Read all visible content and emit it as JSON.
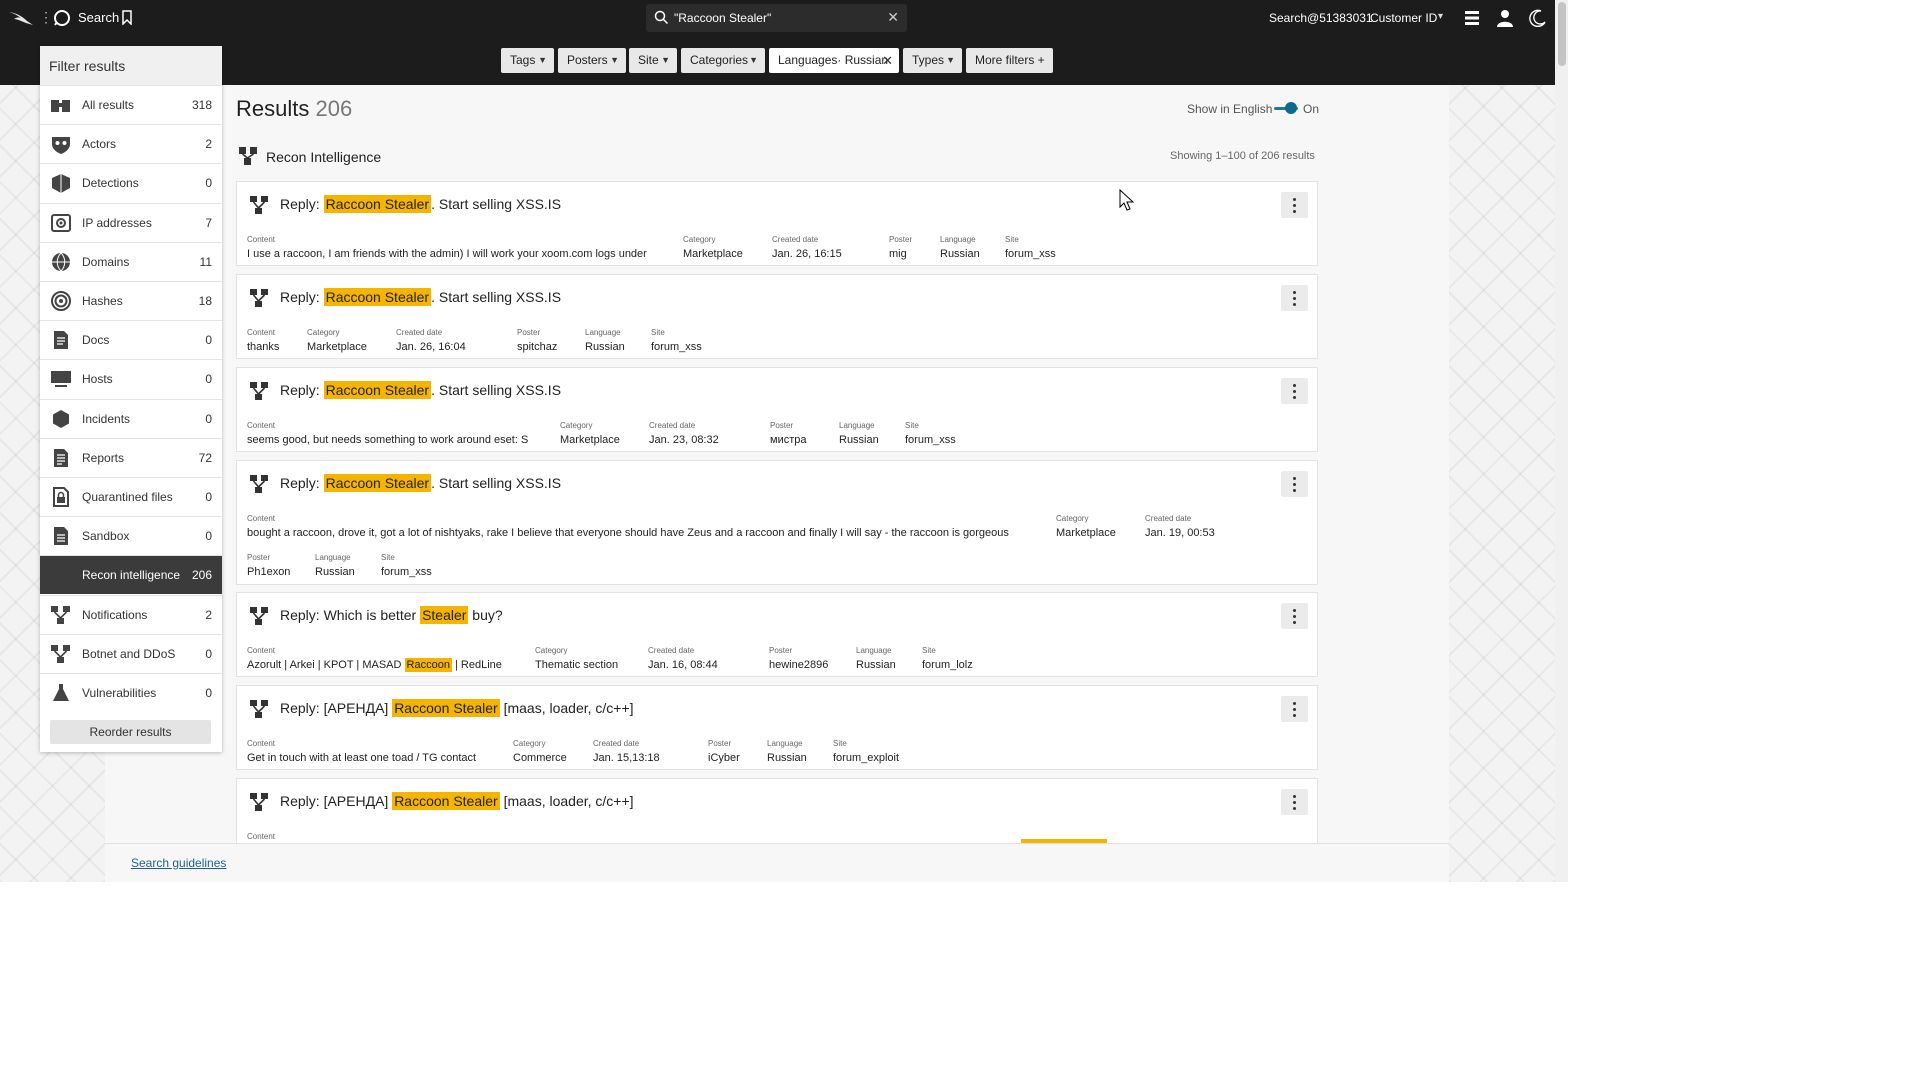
{
  "topbar": {
    "search_label": "Search",
    "search_value": "\"Raccoon Stealer\"",
    "user": "Search@51383031",
    "customer_id_label": "Customer ID"
  },
  "filters": [
    {
      "label": "Tags"
    },
    {
      "label": "Posters"
    },
    {
      "label": "Site"
    },
    {
      "label": "Categories"
    },
    {
      "label": "Languages· Russian"
    },
    {
      "label": "Types"
    },
    {
      "label": "More filters +"
    }
  ],
  "sidebar": {
    "title": "Filter results",
    "items": [
      {
        "label": "All results",
        "count": "318",
        "icon": "binoculars-icon"
      },
      {
        "label": "Actors",
        "count": "2",
        "icon": "mask-icon"
      },
      {
        "label": "Detections",
        "count": "0",
        "icon": "shield-icon"
      },
      {
        "label": "IP addresses",
        "count": "7",
        "icon": "ip-icon"
      },
      {
        "label": "Domains",
        "count": "11",
        "icon": "globe-icon"
      },
      {
        "label": "Hashes",
        "count": "18",
        "icon": "fingerprint-icon"
      },
      {
        "label": "Docs",
        "count": "0",
        "icon": "document-icon"
      },
      {
        "label": "Hosts",
        "count": "0",
        "icon": "monitor-icon"
      },
      {
        "label": "Incidents",
        "count": "0",
        "icon": "hexagon-icon"
      },
      {
        "label": "Reports",
        "count": "72",
        "icon": "report-icon"
      },
      {
        "label": "Quarantined files",
        "count": "0",
        "icon": "lock-file-icon"
      },
      {
        "label": "Sandbox",
        "count": "0",
        "icon": "sandbox-icon"
      },
      {
        "label": "Recon intelligence",
        "count": "206",
        "icon": "recon-icon",
        "selected": true
      },
      {
        "label": "Notifications",
        "count": "2",
        "icon": "recon-icon"
      },
      {
        "label": "Botnet and DDoS",
        "count": "0",
        "icon": "recon-icon"
      },
      {
        "label": "Vulnerabilities",
        "count": "0",
        "icon": "flask-icon"
      }
    ],
    "reorder_label": "Reorder results"
  },
  "main": {
    "results_label": "Results",
    "results_count": "206",
    "show_in_english": "Show in English",
    "toggle_state": "On",
    "section_title": "Recon Intelligence",
    "showing": "Showing 1–100 of 206 results",
    "search_guidelines": "Search guidelines"
  },
  "results": [
    {
      "title_prefix": "Reply: ",
      "highlight": "Raccoon Stealer",
      "title_suffix": ". Start selling XSS.IS",
      "content": "I use a raccoon, I am friends with the admin) I will work your xoom.com logs under",
      "category": "Marketplace",
      "created": "Jan. 26, 16:15",
      "poster": "mig",
      "language": "Russian",
      "site": "forum_xss"
    },
    {
      "title_prefix": "Reply: ",
      "highlight": "Raccoon Stealer",
      "title_suffix": ". Start selling XSS.IS",
      "content": "thanks",
      "category": "Marketplace",
      "created": "Jan. 26, 16:04",
      "poster": "spitchaz",
      "language": "Russian",
      "site": "forum_xss"
    },
    {
      "title_prefix": "Reply: ",
      "highlight": "Raccoon Stealer",
      "title_suffix": ". Start selling XSS.IS",
      "content": "seems good, but needs something to work around eset: S",
      "category": "Marketplace",
      "created": "Jan. 23, 08:32",
      "poster": "мистра",
      "language": "Russian",
      "site": "forum_xss"
    },
    {
      "title_prefix": "Reply: ",
      "highlight": "Raccoon Stealer",
      "title_suffix": ". Start selling XSS.IS",
      "content": "bought a raccoon, drove it, got a lot of nishtyaks, rake I believe that everyone should have Zeus and a raccoon and finally I will say - the raccoon is gorgeous",
      "category": "Marketplace",
      "created": "Jan. 19, 00:53",
      "poster": "Ph1exon",
      "language": "Russian",
      "site": "forum_xss"
    },
    {
      "title_prefix": "Reply: Which is better ",
      "highlight": "Stealer",
      "title_suffix": " buy?",
      "content_prefix": "Azorult | Arkei | KPOT | MASAD ",
      "content_highlight": "Raccoon",
      "content_suffix": " | RedLine",
      "category": "Thematic section",
      "created": "Jan. 16, 08:44",
      "poster": "hewine2896",
      "language": "Russian",
      "site": "forum_lolz"
    },
    {
      "title_prefix": "Reply: [АРЕНДА] ",
      "highlight": "Raccoon Stealer",
      "title_suffix": " [maas, loader, c/c++]",
      "content": "Get in touch with at least one toad / TG contact",
      "category": "Commerce",
      "created": "Jan. 15,13:18",
      "poster": "iCyber",
      "language": "Russian",
      "site": "forum_exploit"
    },
    {
      "title_prefix": "Reply: [АРЕНДА] ",
      "highlight": "Raccoon Stealer",
      "title_suffix": " [maas, loader, c/c++]"
    }
  ],
  "field_labels": {
    "content": "Content",
    "category": "Category",
    "created": "Created date",
    "poster": "Poster",
    "language": "Language",
    "site": "Site"
  }
}
